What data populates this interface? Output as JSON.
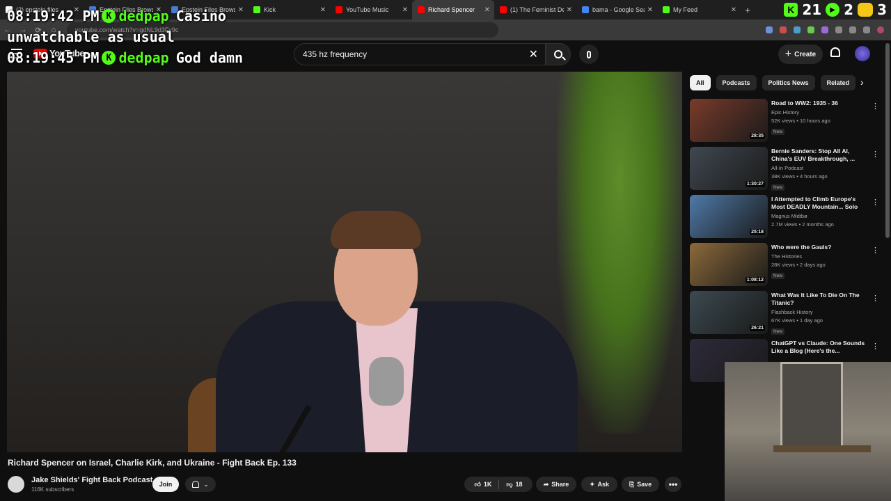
{
  "browser": {
    "tabs": [
      {
        "label": "(2) epstein files",
        "color": "#ffffff"
      },
      {
        "label": "Epstein Files Browse",
        "color": "#4a7bd1"
      },
      {
        "label": "Epstein Files Browse",
        "color": "#4a7bd1"
      },
      {
        "label": "Kick",
        "color": "#53fc18"
      },
      {
        "label": "YouTube Music",
        "color": "#ff0000"
      },
      {
        "label": "Richard Spencer",
        "color": "#ff0000",
        "active": true
      },
      {
        "label": "(1) The Feminist De",
        "color": "#ff0000"
      },
      {
        "label": "bama - Google Sea",
        "color": "#4285f4"
      },
      {
        "label": "My Feed",
        "color": "#53fc18"
      }
    ],
    "tray": {
      "num1": "21",
      "num2": "2",
      "num3": "3"
    },
    "url": "youtube.com/watch?v=gdNL9d3Fv9c"
  },
  "chat": [
    {
      "time": "08:19:42 PM",
      "user": "dedpap",
      "msg": "Casino"
    },
    {
      "continuation": "unwatchable as usual"
    },
    {
      "time": "08:19:45 PM",
      "user": "dedpap",
      "msg": "God damn"
    }
  ],
  "header": {
    "logo": "YouTube",
    "search_value": "435 hz frequency",
    "create_label": "Create"
  },
  "video": {
    "title": "Richard Spencer on Israel, Charlie Kirk, and Ukraine - Fight Back Ep. 133",
    "channel": "Jake Shields' Fight Back Podcast",
    "subscribers": "116K subscribers",
    "join_label": "Join",
    "likes": "1K",
    "dislikes": "18",
    "share_label": "Share",
    "ask_label": "Ask",
    "save_label": "Save"
  },
  "chips": [
    "All",
    "Podcasts",
    "Politics News",
    "Related"
  ],
  "recommendations": [
    {
      "title": "Road to WW2: 1935 - 36",
      "channel": "Epic History",
      "meta": "52K views • 10 hours ago",
      "duration": "28:35",
      "new": "New",
      "thumb": "#7a3b2a"
    },
    {
      "title": "Bernie Sanders: Stop All AI, China's EUV Breakthrough, ...",
      "channel": "All-In Podcast",
      "meta": "38K views • 4 hours ago",
      "duration": "1:30:27",
      "new": "New",
      "thumb": "#404850"
    },
    {
      "title": "I Attempted to Climb Europe's Most DEADLY Mountain... Solo",
      "channel": "Magnus Midtbø",
      "meta": "2.7M views • 2 months ago",
      "duration": "25:18",
      "new": "",
      "thumb": "#4f7aa8"
    },
    {
      "title": "Who were the Gauls?",
      "channel": "The Histories",
      "meta": "28K views • 2 days ago",
      "duration": "1:08:12",
      "new": "New",
      "thumb": "#8c6a3a"
    },
    {
      "title": "What Was It Like To Die On The Titanic?",
      "channel": "Flashback History",
      "meta": "67K views • 1 day ago",
      "duration": "26:21",
      "new": "New",
      "thumb": "#3c4a50"
    },
    {
      "title": "ChatGPT vs Claude: One Sounds Like a Blog (Here's the...",
      "channel": "",
      "meta": "",
      "duration": "",
      "new": "",
      "thumb": "#2e2a3a"
    }
  ]
}
